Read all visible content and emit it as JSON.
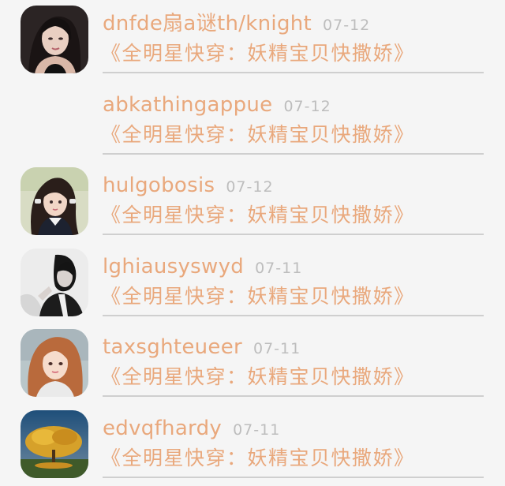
{
  "comments": [
    {
      "username": "dnfde扇a谜th/knight",
      "date": "07-12",
      "book": "《全明星快穿：妖精宝贝快撒娇》"
    },
    {
      "username": "abkathingappue",
      "date": "07-12",
      "book": "《全明星快穿：妖精宝贝快撒娇》"
    },
    {
      "username": "hulgobosis",
      "date": "07-12",
      "book": "《全明星快穿：妖精宝贝快撒娇》"
    },
    {
      "username": "lghiausyswyd",
      "date": "07-11",
      "book": "《全明星快穿：妖精宝贝快撒娇》"
    },
    {
      "username": "taxsghteueer",
      "date": "07-11",
      "book": "《全明星快穿：妖精宝贝快撒娇》"
    },
    {
      "username": "edvqfhardy",
      "date": "07-11",
      "book": "《全明星快穿：妖精宝贝快撒娇》"
    }
  ],
  "colors": {
    "accent": "#e9a87c",
    "date": "#bdbdbd",
    "divider": "#cfcfcf",
    "background": "#f5f5f5"
  }
}
